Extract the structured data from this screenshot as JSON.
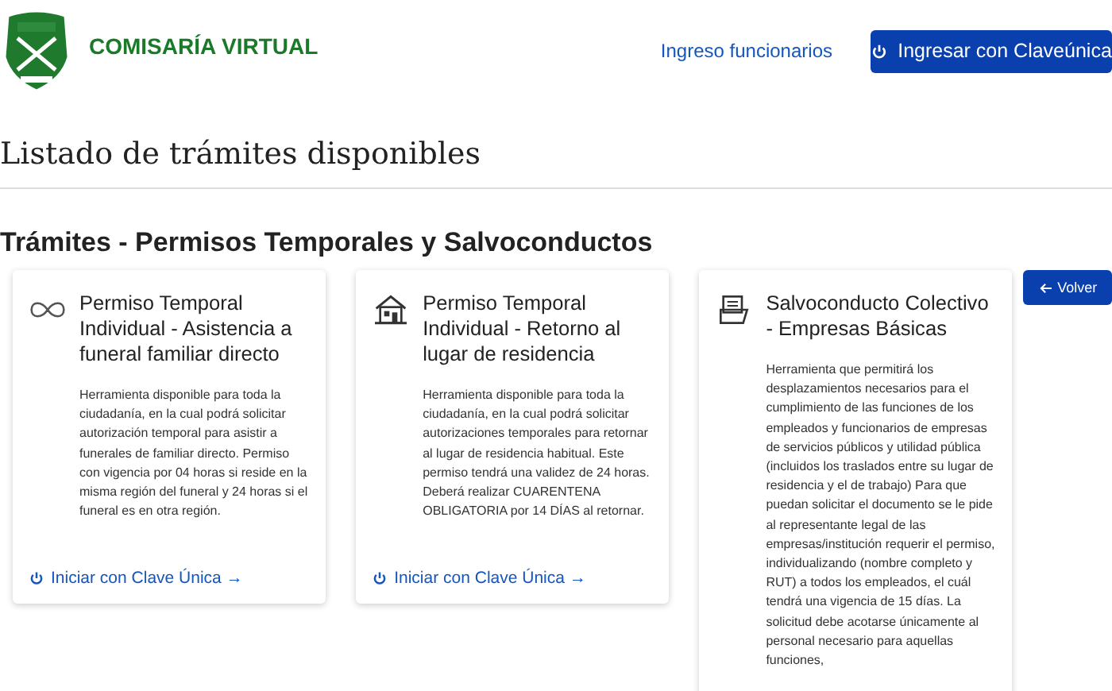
{
  "header": {
    "brand": "COMISARÍA VIRTUAL",
    "link": "Ingreso funcionarios",
    "login_button": "Ingresar con Claveúnica"
  },
  "page_title": "Listado de trámites disponibles",
  "section_title": "Trámites - Permisos Temporales y Salvoconductos",
  "back_button": "Volver",
  "cards": [
    {
      "kind": "infinity",
      "title": "Permiso Temporal Individual - Asistencia a funeral familiar directo",
      "description": "Herramienta disponible para toda la ciudadanía, en la cual podrá solicitar autorización temporal para asistir a funerales de familiar directo. Permiso con vigencia por 04 horas si reside en la misma región del funeral y 24 horas si el funeral es en otra región.",
      "action": "Iniciar con Clave Única →"
    },
    {
      "kind": "house",
      "title": "Permiso Temporal Individual - Retorno al lugar de residencia",
      "description": "Herramienta disponible para toda la ciudadanía, en la cual podrá solicitar autorizaciones temporales para retornar al lugar de residencia habitual. Este permiso tendrá una validez de 24 horas. Deberá realizar CUARENTENA OBLIGATORIA por 14 DÍAS al retornar.",
      "action": "Iniciar con Clave Única →"
    },
    {
      "kind": "document",
      "title": "Salvoconducto Colectivo - Empresas Básicas",
      "description": "Herramienta que permitirá los desplazamientos necesarios para el cumplimiento de las funciones de los empleados y funcionarios de empresas de servicios públicos y utilidad pública (incluidos los traslados entre su lugar de residencia y el de trabajo) Para que puedan solicitar el documento se le pide al representante legal de las empresas/institución requerir el permiso, individualizando (nombre completo y RUT) a todos los empleados, el cuál tendrá una vigencia de 15 días. La solicitud debe acotarse únicamente al personal necesario para aquellas funciones,"
    }
  ]
}
